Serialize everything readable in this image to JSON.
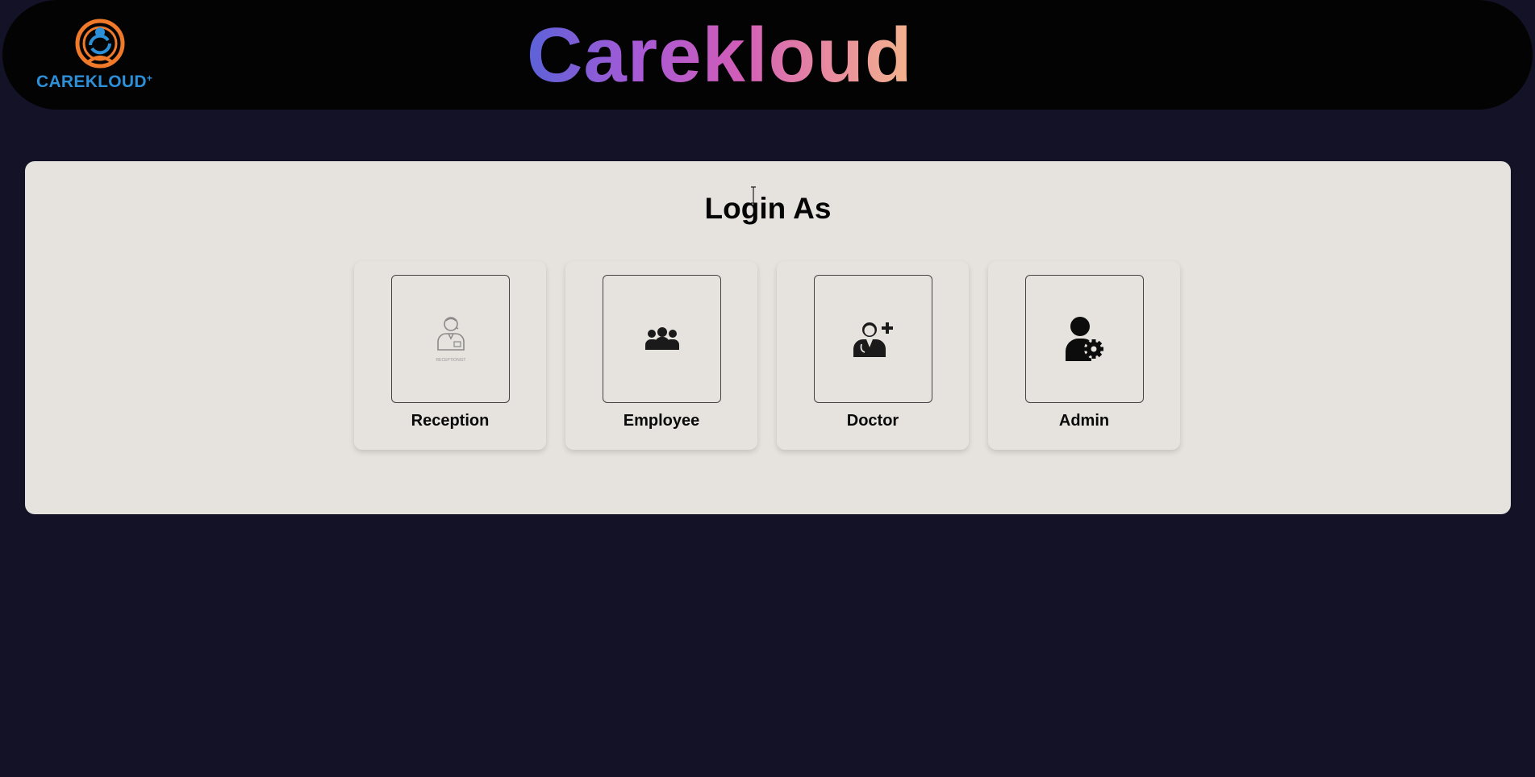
{
  "header": {
    "logo_text": "CAREKLOUD",
    "title": "Carekloud"
  },
  "login": {
    "heading": "Login As",
    "roles": [
      {
        "label": "Reception",
        "icon": "receptionist-icon",
        "icon_caption": "RECEPTIONIST"
      },
      {
        "label": "Employee",
        "icon": "employees-group-icon"
      },
      {
        "label": "Doctor",
        "icon": "doctor-plus-icon"
      },
      {
        "label": "Admin",
        "icon": "admin-gear-icon"
      }
    ]
  },
  "colors": {
    "page_bg": "#131226",
    "header_bg": "#030303",
    "panel_bg": "#e6e2de",
    "logo_orange": "#f07a2a",
    "logo_blue": "#2d8fd8",
    "title_gradient": [
      "#5b62d8",
      "#a65ad6",
      "#d15db8",
      "#e88aa0",
      "#f3b48c"
    ]
  }
}
